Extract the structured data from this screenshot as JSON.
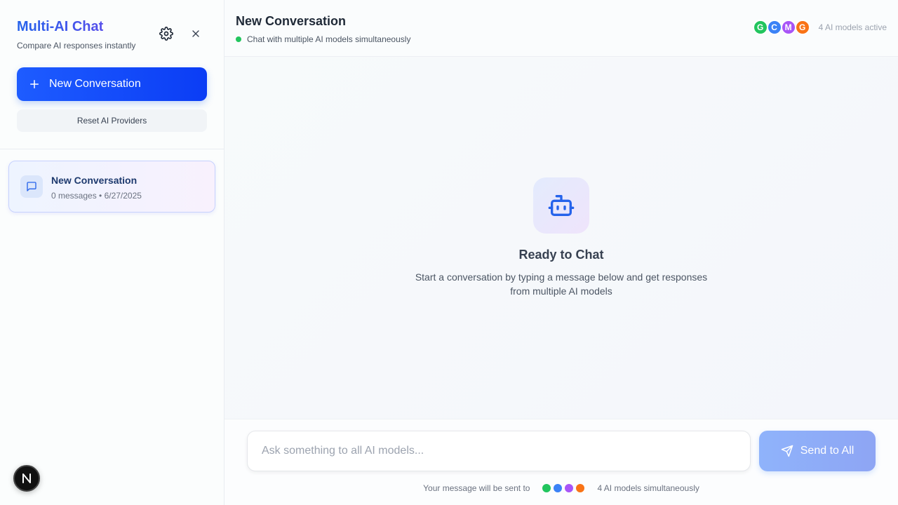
{
  "sidebar": {
    "title": "Multi-AI Chat",
    "subtitle": "Compare AI responses instantly",
    "settings_icon": "gear-icon",
    "close_icon": "close-icon",
    "new_conversation_label": "New Conversation",
    "reset_label": "Reset AI Providers",
    "conversations": [
      {
        "title": "New Conversation",
        "meta": "0 messages • 6/27/2025",
        "icon": "message-square-icon"
      }
    ],
    "badge_letter": "N"
  },
  "header": {
    "title": "New Conversation",
    "status": "Chat with multiple AI models simultaneously",
    "status_color": "#22c55e",
    "models": [
      {
        "letter": "G",
        "color": "#22c55e"
      },
      {
        "letter": "C",
        "color": "#3b82f6"
      },
      {
        "letter": "M",
        "color": "#a855f7"
      },
      {
        "letter": "G",
        "color": "#f97316"
      }
    ],
    "models_count": "4 AI models active"
  },
  "empty_state": {
    "icon": "bot-icon",
    "title": "Ready to Chat",
    "subtitle": "Start a conversation by typing a message below and get responses from multiple AI models"
  },
  "composer": {
    "placeholder": "Ask something to all AI models...",
    "value": "",
    "send_label": "Send to All",
    "footnote_prefix": "Your message will be sent to",
    "footnote_suffix": "4 AI models simultaneously",
    "dot_colors": [
      "#22c55e",
      "#3b82f6",
      "#a855f7",
      "#f97316"
    ]
  },
  "colors": {
    "accent": "#1e5cff",
    "brand_gradient_start": "#2563eb",
    "brand_gradient_end": "#9333ea"
  }
}
